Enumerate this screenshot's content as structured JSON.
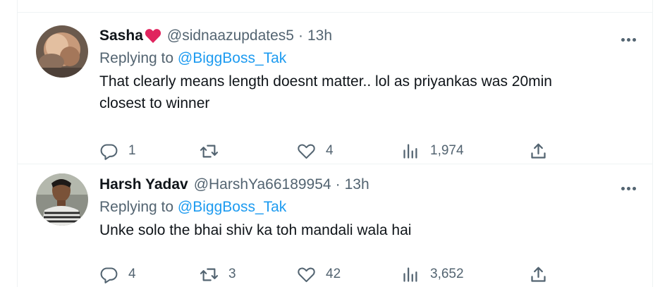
{
  "tweets": [
    {
      "name": "Sasha",
      "name_emoji": "heart-emoji",
      "handle": "@sidnaazupdates5",
      "separator": "·",
      "time": "13h",
      "replying_prefix": "Replying to",
      "replying_to": "@BiggBoss_Tak",
      "text_lines": [
        "That clearly means length doesnt matter.. lol as priyankas was 20min",
        "closest to winner"
      ],
      "replies": "1",
      "retweets": "",
      "likes": "4",
      "views": "1,974"
    },
    {
      "name": "Harsh Yadav",
      "handle": "@HarshYa66189954",
      "separator": "·",
      "time": "13h",
      "replying_prefix": "Replying to",
      "replying_to": "@BiggBoss_Tak",
      "text_lines": [
        "Unke solo the bhai shiv ka toh mandali wala hai"
      ],
      "replies": "4",
      "retweets": "3",
      "likes": "42",
      "views": "3,652"
    }
  ],
  "icons": {
    "reply": "comment-icon",
    "retweet": "retweet-icon",
    "like": "heart-icon",
    "views": "views-icon",
    "share": "share-icon",
    "more": "more-icon"
  },
  "colors": {
    "text": "#0f1419",
    "muted": "#536471",
    "link": "#1d9bf0",
    "border": "#eff3f4",
    "heart_emoji": "#e0245e"
  }
}
